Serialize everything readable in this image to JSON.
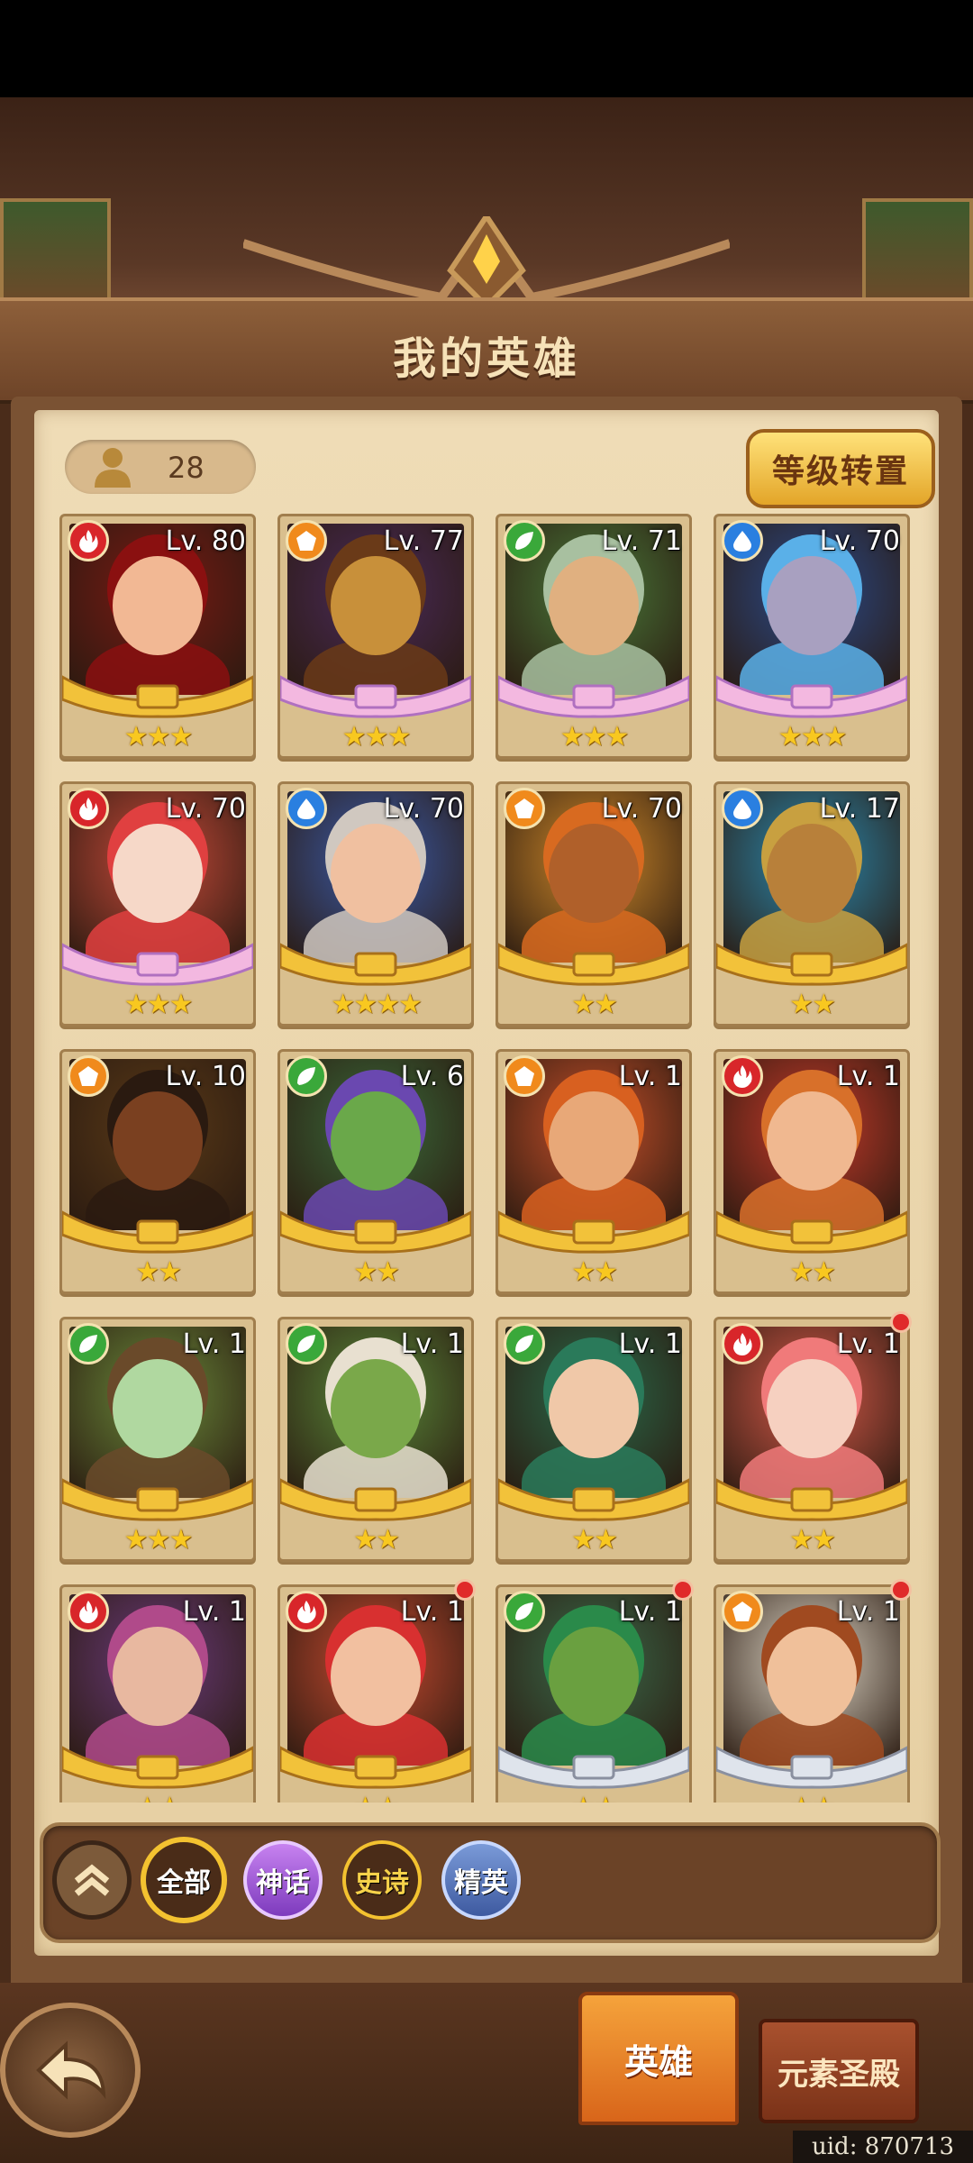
{
  "header": {
    "title": "我的英雄"
  },
  "hero_count": "28",
  "level_transfer_label": "等级转置",
  "colors": {
    "fire": "#d8262a",
    "earth": "#f08a1c",
    "nature": "#3aa83a",
    "water": "#2a7fe0",
    "myth": "#a05ad8",
    "epic": "#f3c230",
    "elite": "#4a6ab8"
  },
  "heroes": [
    {
      "level": "Lv. 80",
      "element": "fire",
      "stars": "★★★",
      "frame": "gold",
      "skin": "#f2b894",
      "bg": "#7a1a14",
      "hair": "#8a1010",
      "badge": false
    },
    {
      "level": "Lv. 77",
      "element": "earth",
      "stars": "★★★",
      "frame": "myth",
      "skin": "#c8903a",
      "bg": "#4a2a5a",
      "hair": "#6a3a18",
      "badge": false
    },
    {
      "level": "Lv. 71",
      "element": "nature",
      "stars": "★★★",
      "frame": "myth",
      "skin": "#e0b080",
      "bg": "#4a7a3a",
      "hair": "#a8c0a0",
      "badge": false
    },
    {
      "level": "Lv. 70",
      "element": "water",
      "stars": "★★★",
      "frame": "myth",
      "skin": "#a8a0c0",
      "bg": "#2a4a8a",
      "hair": "#5ab0e8",
      "badge": false
    },
    {
      "level": "Lv. 70",
      "element": "fire",
      "stars": "★★★",
      "frame": "myth",
      "skin": "#f6d8c8",
      "bg": "#c84a3a",
      "hair": "#e04040",
      "badge": false
    },
    {
      "level": "Lv. 70",
      "element": "water",
      "stars": "★★★★",
      "frame": "gold",
      "skin": "#f0c0a0",
      "bg": "#3a5aa8",
      "hair": "#d0c8c0",
      "badge": false
    },
    {
      "level": "Lv. 70",
      "element": "earth",
      "stars": "★★",
      "frame": "gold",
      "skin": "#b0602a",
      "bg": "#d08a2a",
      "hair": "#d86a20",
      "badge": false
    },
    {
      "level": "Lv. 17",
      "element": "water",
      "stars": "★★",
      "frame": "gold",
      "skin": "#b8803a",
      "bg": "#2a8ab0",
      "hair": "#c8a040",
      "badge": false
    },
    {
      "level": "Lv. 10",
      "element": "earth",
      "stars": "★★",
      "frame": "gold",
      "skin": "#7a4020",
      "bg": "#5a3a18",
      "hair": "#2a1a10",
      "badge": false
    },
    {
      "level": "Lv. 6",
      "element": "nature",
      "stars": "★★",
      "frame": "gold",
      "skin": "#6aa84a",
      "bg": "#3a6a3a",
      "hair": "#6a48b0",
      "badge": false
    },
    {
      "level": "Lv. 1",
      "element": "earth",
      "stars": "★★",
      "frame": "gold",
      "skin": "#e8a878",
      "bg": "#c8502a",
      "hair": "#d86020",
      "badge": false
    },
    {
      "level": "Lv. 1",
      "element": "fire",
      "stars": "★★",
      "frame": "gold",
      "skin": "#f0b890",
      "bg": "#c83a2a",
      "hair": "#d8702a",
      "badge": false
    },
    {
      "level": "Lv. 1",
      "element": "nature",
      "stars": "★★★",
      "frame": "gold",
      "skin": "#b0d8a0",
      "bg": "#6a8a3a",
      "hair": "#6a4a2a",
      "badge": false
    },
    {
      "level": "Lv. 1",
      "element": "nature",
      "stars": "★★",
      "frame": "gold",
      "skin": "#7aa84a",
      "bg": "#5a8a3a",
      "hair": "#e8e0d0",
      "badge": false
    },
    {
      "level": "Lv. 1",
      "element": "nature",
      "stars": "★★",
      "frame": "gold",
      "skin": "#f0c8a8",
      "bg": "#2a6a4a",
      "hair": "#2a7a5a",
      "badge": false
    },
    {
      "level": "Lv. 1",
      "element": "fire",
      "stars": "★★",
      "frame": "gold",
      "skin": "#f6d0c0",
      "bg": "#d85a4a",
      "hair": "#f07a7a",
      "badge": true
    },
    {
      "level": "Lv. 1",
      "element": "fire",
      "stars": "★★",
      "frame": "gold",
      "skin": "#e8b8a0",
      "bg": "#6a3a7a",
      "hair": "#b04a8a",
      "badge": false
    },
    {
      "level": "Lv. 1",
      "element": "fire",
      "stars": "★★",
      "frame": "gold",
      "skin": "#f2c0a0",
      "bg": "#c84a30",
      "hair": "#d83030",
      "badge": true
    },
    {
      "level": "Lv. 1",
      "element": "nature",
      "stars": "★★",
      "frame": "silver",
      "skin": "#6aa040",
      "bg": "#3a6a4a",
      "hair": "#2a8a4a",
      "badge": true
    },
    {
      "level": "Lv. 1",
      "element": "earth",
      "stars": "★★",
      "frame": "silver",
      "skin": "#f0c09a",
      "bg": "#e0d8c8",
      "hair": "#a04a20",
      "badge": true
    }
  ],
  "filters": {
    "all": "全部",
    "myth": "神话",
    "epic": "史诗",
    "elite": "精英"
  },
  "tabs": {
    "hero": "英雄",
    "temple": "元素圣殿"
  },
  "uid": "uid: 870713"
}
